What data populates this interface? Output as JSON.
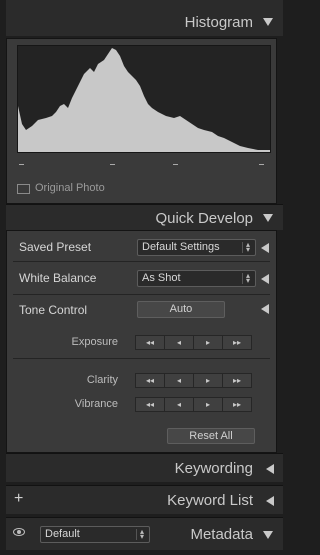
{
  "histogram": {
    "title": "Histogram",
    "original_photo_label": "Original Photo",
    "curve_color": "#c8c8c8"
  },
  "quick_develop": {
    "title": "Quick Develop",
    "saved_preset": {
      "label": "Saved Preset",
      "value": "Default Settings"
    },
    "white_balance": {
      "label": "White Balance",
      "value": "As Shot"
    },
    "tone_control": {
      "label": "Tone Control",
      "auto_label": "Auto"
    },
    "adjustments": [
      {
        "label": "Exposure"
      },
      {
        "label": "Clarity"
      },
      {
        "label": "Vibrance"
      }
    ],
    "step_glyphs": [
      "◂◂",
      "◂",
      "▸",
      "▸▸"
    ],
    "reset_label": "Reset All"
  },
  "keywording": {
    "title": "Keywording"
  },
  "keyword_list": {
    "title": "Keyword List",
    "add_glyph": "+"
  },
  "metadata": {
    "title": "Metadata",
    "preset_value": "Default"
  }
}
